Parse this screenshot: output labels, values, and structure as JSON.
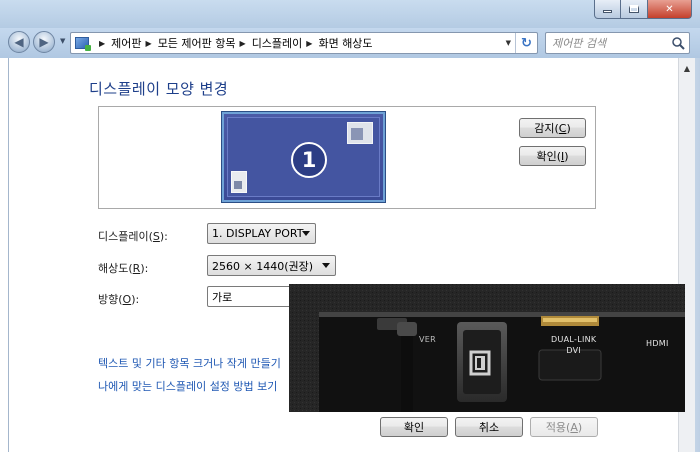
{
  "window": {
    "title": "",
    "controls": [
      "minimize",
      "maximize",
      "close"
    ]
  },
  "navigation": {
    "breadcrumbs": [
      "제어판",
      "모든 제어판 항목",
      "디스플레이",
      "화면 해상도"
    ],
    "search_placeholder": "제어판 검색"
  },
  "page": {
    "title": "디스플레이 모양 변경",
    "monitor_number": "1",
    "detect_button": {
      "text": "감지(",
      "key": "C",
      "end": ")"
    },
    "identify_button": {
      "text": "확인(",
      "key": "I",
      "end": ")"
    }
  },
  "form": {
    "display": {
      "label_text": "디스플레이(",
      "label_key": "S",
      "label_end": "):",
      "value": "1. DISPLAY PORT"
    },
    "resolution": {
      "label_text": "해상도(",
      "label_key": "R",
      "label_end": "):",
      "value": "2560 × 1440(권장)"
    },
    "orientation": {
      "label_text": "방향(",
      "label_key": "O",
      "label_end": "):",
      "value": "가로"
    }
  },
  "links": [
    "텍스트 및 기타 항목 크거나 작게 만들기",
    "나에게 맞는 디스플레이 설정 방법 보기"
  ],
  "photo": {
    "labels": {
      "ver": "VER",
      "dvi_line1": "DUAL-LINK",
      "dvi_line2": "DVI",
      "hdmi": "HDMI"
    }
  },
  "footer": {
    "ok": "확인",
    "cancel": "취소",
    "apply": {
      "text": "적용(",
      "key": "A",
      "end": ")"
    }
  }
}
